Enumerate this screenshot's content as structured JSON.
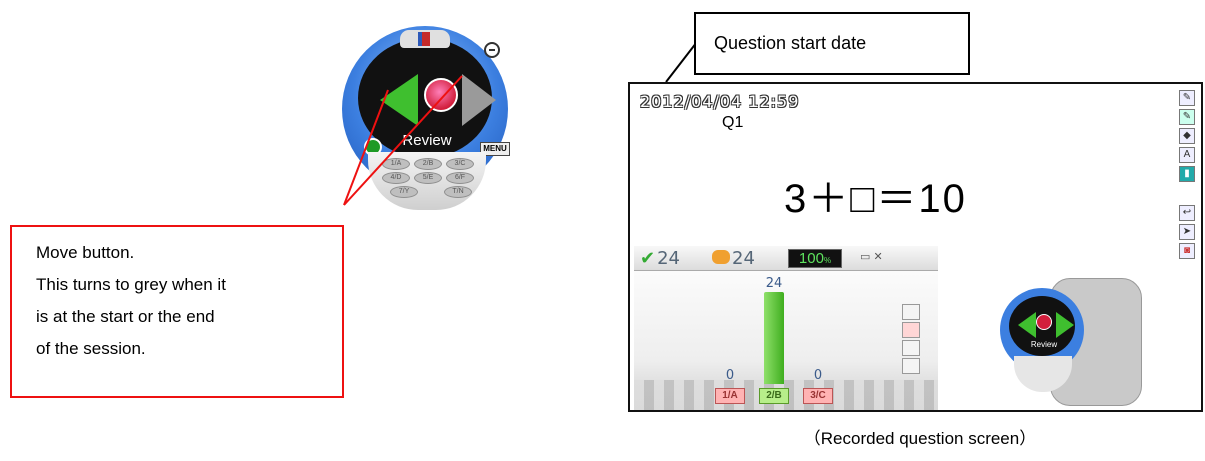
{
  "remote": {
    "screen_label": "Review",
    "menu_label": "MENU",
    "keys": [
      "1/A",
      "2/B",
      "3/C",
      "4/D",
      "5/E",
      "6/F",
      "7/Y",
      "T/N"
    ]
  },
  "move_callout": {
    "lines": [
      "Move button.",
      "This turns to grey when it",
      "is at the start or the end",
      "of the session."
    ]
  },
  "start_date_callout": {
    "label": "Question start date"
  },
  "recorded_screen": {
    "timestamp": "2012/04/04 12:59",
    "question_number": "Q1",
    "equation": "3＋□＝10",
    "stats": {
      "answered": "24",
      "participants": "24",
      "percent": "100"
    },
    "chart_data": {
      "type": "bar",
      "categories": [
        "1/A",
        "2/B",
        "3/C"
      ],
      "values": [
        0,
        24,
        0
      ],
      "correct_category": "2/B"
    },
    "mini_remote_label": "Review"
  },
  "caption": "（Recorded question screen）",
  "colors": {
    "callout_red": "#e11111",
    "correct_green": "#3fae1f",
    "remote_blue": "#3c7fe0"
  }
}
